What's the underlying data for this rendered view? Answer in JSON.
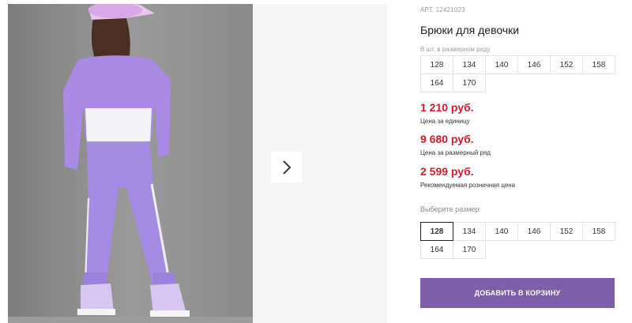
{
  "gallery": {
    "next_icon": "chevron-right-icon"
  },
  "product": {
    "sku_label": "АРТ.",
    "sku": "12421023",
    "title": "Брюки для девочки",
    "row_label": "В шт. в размерном ряду",
    "row_sizes": [
      "128",
      "134",
      "140",
      "146",
      "152",
      "158",
      "164",
      "170"
    ],
    "prices": [
      {
        "value": "1 210 руб.",
        "note": "Цена за единицу"
      },
      {
        "value": "9 680 руб.",
        "note": "Цена за размерный ряд"
      },
      {
        "value": "2 599 руб.",
        "note": "Рекомендуемая розничная цена"
      }
    ],
    "choose_label": "Выберите размер:",
    "select_sizes": [
      "128",
      "134",
      "140",
      "146",
      "152",
      "158",
      "164",
      "170"
    ],
    "selected_size": "128",
    "add_to_cart": "ДОБАВИТЬ В КОРЗИНУ"
  },
  "colors": {
    "price": "#d71a2a",
    "button": "#7e5ea9",
    "outfit": "#a98be6"
  }
}
